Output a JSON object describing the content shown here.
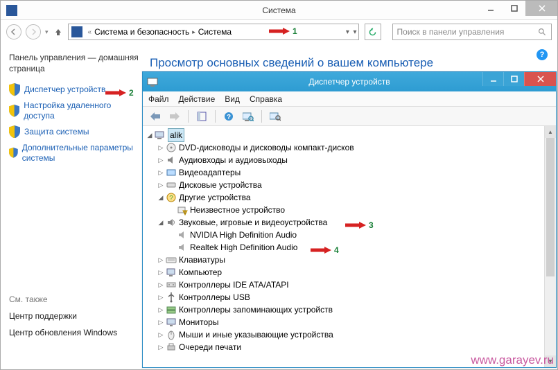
{
  "sys": {
    "title": "Система",
    "breadcrumb": {
      "sep": "«",
      "a": "Система и безопасность",
      "b": "Система"
    },
    "search_placeholder": "Поиск в панели управления",
    "sidebar": {
      "heading": "Панель управления — домашняя страница",
      "links": [
        "Диспетчер устройств",
        "Настройка удаленного доступа",
        "Защита системы",
        "Дополнительные параметры системы"
      ],
      "see_also": "См. также",
      "plain": [
        "Центр поддержки",
        "Центр обновления Windows"
      ]
    },
    "main_heading": "Просмотр основных сведений о вашем компьютере"
  },
  "dm": {
    "title": "Диспетчер устройств",
    "menu": [
      "Файл",
      "Действие",
      "Вид",
      "Справка"
    ],
    "root": "alik",
    "nodes": [
      {
        "label": "DVD-дисководы и дисководы компакт-дисков",
        "icon": "disc"
      },
      {
        "label": "Аудиовходы и аудиовыходы",
        "icon": "aud"
      },
      {
        "label": "Видеоадаптеры",
        "icon": "vid"
      },
      {
        "label": "Дисковые устройства",
        "icon": "disk"
      },
      {
        "label": "Другие устройства",
        "icon": "other",
        "expanded": true,
        "children": [
          {
            "label": "Неизвестное устройство",
            "icon": "warn"
          }
        ]
      },
      {
        "label": "Звуковые, игровые и видеоустройства",
        "icon": "sound",
        "expanded": true,
        "children": [
          {
            "label": "NVIDIA High Definition Audio",
            "icon": "sound"
          },
          {
            "label": "Realtek High Definition Audio",
            "icon": "sound"
          }
        ]
      },
      {
        "label": "Клавиатуры",
        "icon": "kbd"
      },
      {
        "label": "Компьютер",
        "icon": "pc"
      },
      {
        "label": "Контроллеры IDE ATA/ATAPI",
        "icon": "ide"
      },
      {
        "label": "Контроллеры USB",
        "icon": "usb"
      },
      {
        "label": "Контроллеры запоминающих устройств",
        "icon": "stor"
      },
      {
        "label": "Мониторы",
        "icon": "mon"
      },
      {
        "label": "Мыши и иные указывающие устройства",
        "icon": "mouse"
      },
      {
        "label": "Очереди печати",
        "icon": "print"
      }
    ]
  },
  "annotations": {
    "1": "1",
    "2": "2",
    "3": "3",
    "4": "4"
  },
  "watermark": "www.garayev.ru"
}
